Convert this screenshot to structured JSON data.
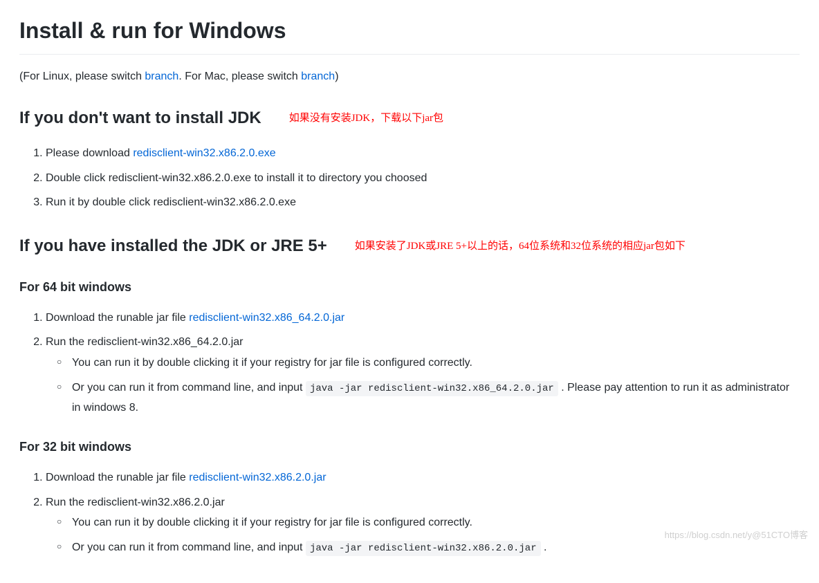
{
  "h1": "Install & run for Windows",
  "intro": {
    "p1a": "(For Linux, please switch ",
    "link1": "branch",
    "p1b": ". For Mac, please switch ",
    "link2": "branch",
    "p1c": ")"
  },
  "sec1": {
    "heading": "If you don't want to install JDK",
    "anno": "如果没有安装JDK，下载以下jar包",
    "li1a": "Please download ",
    "li1link": "redisclient-win32.x86.2.0.exe",
    "li2": "Double click redisclient-win32.x86.2.0.exe to install it to directory you choosed",
    "li3": "Run it by double click redisclient-win32.x86.2.0.exe"
  },
  "sec2": {
    "heading": "If you have installed the JDK or JRE 5+",
    "anno": "如果安装了JDK或JRE 5+以上的话，64位系统和32位系统的相应jar包如下"
  },
  "sec64": {
    "heading": "For 64 bit windows",
    "li1a": "Download the runable jar file ",
    "li1link": "redisclient-win32.x86_64.2.0.jar",
    "li2": "Run the redisclient-win32.x86_64.2.0.jar",
    "sub1": "You can run it by double clicking it if your registry for jar file is configured correctly.",
    "sub2a": "Or you can run it from command line, and input ",
    "sub2code": "java -jar redisclient-win32.x86_64.2.0.jar",
    "sub2b": " . Please pay attention to run it as administrator in windows 8."
  },
  "sec32": {
    "heading": "For 32 bit windows",
    "li1a": "Download the runable jar file ",
    "li1link": "redisclient-win32.x86.2.0.jar",
    "li2": "Run the redisclient-win32.x86.2.0.jar",
    "sub1": "You can run it by double clicking it if your registry for jar file is configured correctly.",
    "sub2a": "Or you can run it from command line, and input ",
    "sub2code": "java -jar redisclient-win32.x86.2.0.jar",
    "sub2b": " ."
  },
  "watermark": "https://blog.csdn.net/y@51CTO博客"
}
